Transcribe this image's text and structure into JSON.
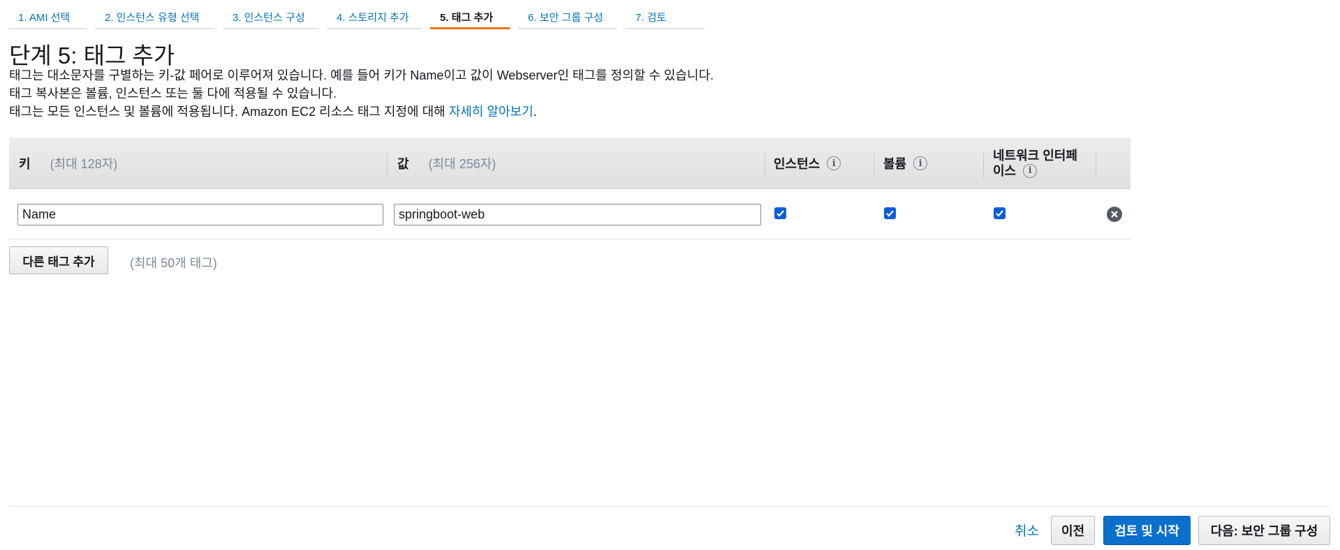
{
  "wizard": {
    "steps": [
      {
        "label": "1. AMI 선택"
      },
      {
        "label": "2. 인스턴스 유형 선택"
      },
      {
        "label": "3. 인스턴스 구성"
      },
      {
        "label": "4. 스토리지 추가"
      },
      {
        "label": "5. 태그 추가"
      },
      {
        "label": "6. 보안 그룹 구성"
      },
      {
        "label": "7. 검토"
      }
    ],
    "active_step": "5. 태그 추가"
  },
  "header": {
    "title": "단계 5: 태그 추가",
    "lines": [
      "태그는 대소문자를 구별하는 키-값 페어로 이루어져 있습니다. 예를 들어 키가 Name이고 값이 Webserver인 태그를 정의할 수 있습니다.",
      "태그 복사본은 볼륨, 인스턴스 또는 둘 다에 적용될 수 있습니다.",
      "태그는 모든 인스턴스 및 볼륨에 적용됩니다. Amazon EC2 리소스 태그 지정에 대해 "
    ],
    "learn_more_link": "자세히 알아보기",
    "learn_more_suffix": "."
  },
  "table": {
    "columns": {
      "key": {
        "label": "키",
        "hint": "(최대 128자)"
      },
      "value": {
        "label": "값",
        "hint": "(최대 256자)"
      },
      "instances": {
        "label": "인스턴스"
      },
      "volumes": {
        "label": "볼륨"
      },
      "network": {
        "label_line1": "네트워크 인터페",
        "label_line2": "이스"
      }
    },
    "rows": [
      {
        "key": "Name",
        "value": "springboot-web",
        "instances": true,
        "volumes": true,
        "network": true
      }
    ]
  },
  "add_tag": {
    "button_label": "다른 태그 추가",
    "hint": "(최대 50개 태그)"
  },
  "footer": {
    "cancel": "취소",
    "previous": "이전",
    "review_launch": "검토 및 시작",
    "next": "다음: 보안 그룹 구성"
  },
  "colors": {
    "link": "#0073bb",
    "active_tab_underline": "#ec7211",
    "primary_button": "#0b6fcc",
    "checkbox": "#0b5ed7"
  }
}
